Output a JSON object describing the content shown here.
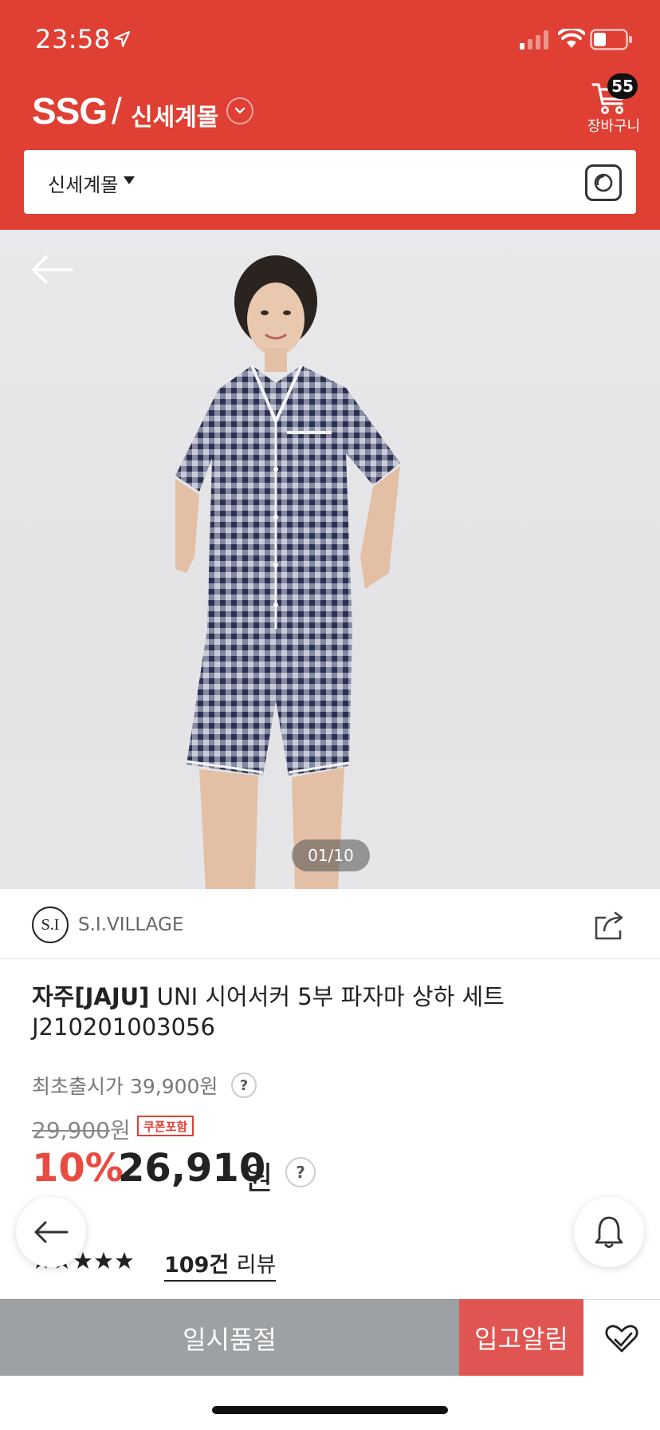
{
  "status_bar": {
    "time": "23:58",
    "icons": [
      "location-arrow-icon",
      "signal-icon",
      "wifi-icon",
      "battery-icon"
    ]
  },
  "header": {
    "logo": "SSG",
    "logo_divider": "/",
    "mall_name": "신세계몰",
    "cart": {
      "count": "55",
      "label": "장바구니"
    },
    "colors": {
      "brand_red": "#e03f33"
    }
  },
  "search": {
    "scope_label": "신세계몰",
    "lens_icon": "camera-lens-icon"
  },
  "gallery": {
    "counter": "01/10",
    "current": 1,
    "total": 10
  },
  "brand": {
    "logo_text": "S.I",
    "name": "S.I.VILLAGE"
  },
  "product": {
    "brand_tag": "자주[JAJU]",
    "title": "UNI 시어서커 5부 파자마 상하 세트",
    "code": "J210201003056",
    "original_launch_price": "최초출시가 39,900원",
    "strike_price": "29,900",
    "strike_unit": "원",
    "coupon_badge": "쿠폰포함",
    "discount": "10%",
    "final_price": "26,910",
    "final_unit": "원",
    "help_glyph": "?"
  },
  "reviews": {
    "rating_stars": 5,
    "count_text": "109건",
    "label": "리뷰"
  },
  "actions": {
    "soldout_label": "일시품절",
    "notify_label": "입고알림",
    "colors": {
      "soldout_gray": "#9ea1a3",
      "notify_red": "#e05452"
    }
  }
}
